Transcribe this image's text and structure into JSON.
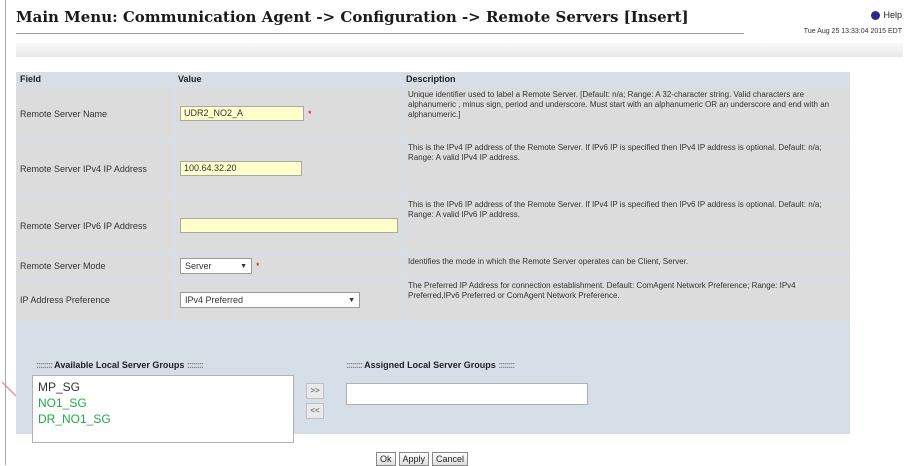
{
  "header": {
    "title": "Main Menu: Communication Agent -> Configuration -> Remote Servers [Insert]",
    "help_label": "Help",
    "timestamp": "Tue Aug 25 13:33:04 2015 EDT"
  },
  "form": {
    "columns": [
      "Field",
      "Value",
      "Description"
    ],
    "rows": [
      {
        "field": "Remote Server Name",
        "value": "UDR2_NO2_A",
        "required_mark": "*",
        "description": "Unique identifier used to label a Remote Server. [Default: n/a; Range: A 32-character string. Valid characters are alphanumeric , minus sign, period and underscore. Must start with an alphanumeric OR an underscore and end with an alphanumeric.]"
      },
      {
        "field": "Remote Server IPv4 IP Address",
        "value": "100.64.32.20",
        "description": "This is the IPv4 IP address of the Remote Server. If IPv6 IP is specified then IPv4 IP address is optional. Default: n/a; Range: A valid IPv4 IP address."
      },
      {
        "field": "Remote Server IPv6 IP Address",
        "value": "",
        "description": "This is the IPv6 IP address of the Remote Server. If IPv4 IP is specified then IPv6 IP address is optional. Default: n/a; Range: A valid IPv6 IP address."
      },
      {
        "field": "Remote Server Mode",
        "value": "Server",
        "required_mark": "*",
        "description": "Identifies the mode in which the Remote Server operates can be Client, Server."
      },
      {
        "field": "IP Address Preference",
        "value": "IPv4 Preferred",
        "description": "The Preferred IP Address for connection establishment. Default: ComAgent Network Preference; Range: IPv4 Preferred,IPv6 Preferred or ComAgent Network Preference."
      }
    ]
  },
  "groups": {
    "available_title": "Available Local Server Groups",
    "assigned_title": "Assigned Local Server Groups",
    "dots": "::::::::",
    "available_items": [
      {
        "label": "MP_SG",
        "color": "#333333"
      },
      {
        "label": "NO1_SG",
        "color": "#22aa44"
      },
      {
        "label": "DR_NO1_SG",
        "color": "#22aa44"
      }
    ],
    "move_right": ">>",
    "move_left": "<<"
  },
  "buttons": {
    "ok": "Ok",
    "apply": "Apply",
    "cancel": "Cancel"
  },
  "colors": {
    "form_bg": "#d6dfe7",
    "row_bg": "#dcdcdc",
    "input_bg": "#ffffcc",
    "required": "#d00000"
  }
}
